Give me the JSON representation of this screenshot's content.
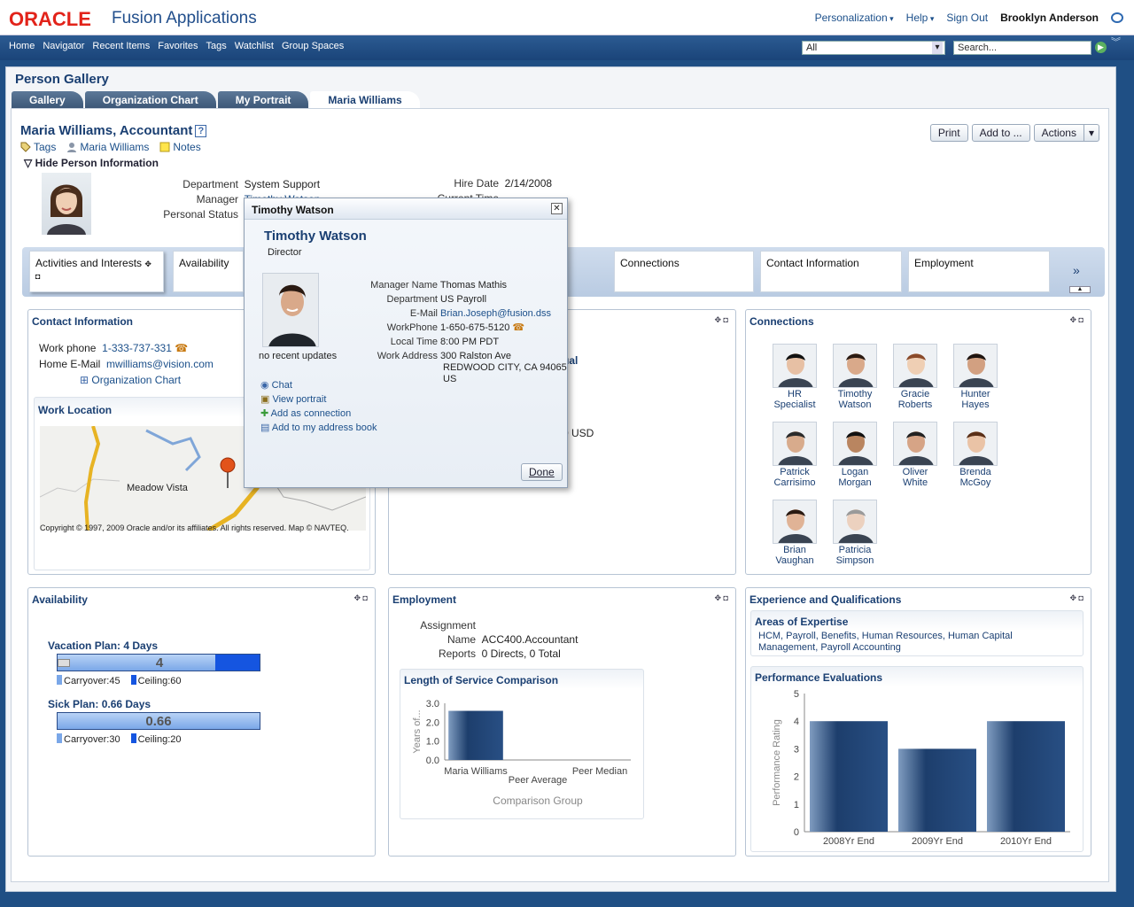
{
  "header": {
    "brand": "ORACLE",
    "product": "Fusion Applications",
    "personalization": "Personalization",
    "help": "Help",
    "signout": "Sign Out",
    "user": "Brooklyn Anderson"
  },
  "nav": {
    "links": [
      "Home",
      "Navigator",
      "Recent Items",
      "Favorites",
      "Tags",
      "Watchlist",
      "Group Spaces"
    ],
    "scope": "All",
    "search_placeholder": "Search..."
  },
  "page": {
    "title": "Person Gallery",
    "tabs": [
      "Gallery",
      "Organization Chart",
      "My Portrait",
      "Maria Williams"
    ]
  },
  "person": {
    "name": "Maria Williams, Accountant",
    "help": "?",
    "tags": "Tags",
    "self": "Maria Williams",
    "notes": "Notes",
    "hide": "Hide Person Information",
    "dept_label": "Department",
    "dept": "System Support",
    "mgr_label": "Manager",
    "mgr": "Timothy Watson",
    "status_label": "Personal Status",
    "hire_label": "Hire Date",
    "hire": "2/14/2008",
    "time_label": "Current Time"
  },
  "actions": {
    "print": "Print",
    "addto": "Add to ...",
    "actions": "Actions"
  },
  "strip": {
    "cards": [
      "Activities and Interests",
      "Availability",
      "Connections",
      "Contact Information",
      "Employment"
    ],
    "more": "»"
  },
  "contact": {
    "title": "Contact Information",
    "phone_label": "Work phone",
    "phone": "1-333-737-331",
    "email_label": "Home E-Mail",
    "email": "mwilliams@vision.com",
    "org": "Organization Chart"
  },
  "work": {
    "title": "Work Location",
    "town": "Meadow Vista",
    "copy": "Copyright © 1997, 2009 Oracle and/or its affiliates. All rights reserved. Map © NAVTEQ."
  },
  "mid": {
    "frag1": "ual",
    "frag2": "0 USD"
  },
  "connections": {
    "title": "Connections",
    "people": [
      {
        "first": "HR Specialist",
        "last": ""
      },
      {
        "first": "Timothy",
        "last": "Watson"
      },
      {
        "first": "Gracie",
        "last": "Roberts"
      },
      {
        "first": "Hunter",
        "last": "Hayes"
      },
      {
        "first": "Patrick",
        "last": "Carrisimo"
      },
      {
        "first": "Logan",
        "last": "Morgan"
      },
      {
        "first": "Oliver",
        "last": "White"
      },
      {
        "first": "Brenda",
        "last": "McGoy"
      },
      {
        "first": "Brian",
        "last": "Vaughan"
      },
      {
        "first": "Patricia",
        "last": "Simpson"
      }
    ]
  },
  "availability": {
    "title": "Availability",
    "vacation": {
      "label": "Vacation Plan: 4 Days",
      "value": "4",
      "fraction": 0.78,
      "carry": "Carryover:45",
      "ceiling": "Ceiling:60"
    },
    "sick": {
      "label": "Sick Plan: 0.66 Days",
      "value": "0.66",
      "carry": "Carryover:30",
      "ceiling": "Ceiling:20"
    }
  },
  "employment": {
    "title": "Employment",
    "assign_label": "Assignment Name",
    "assign": "ACC400.Accountant",
    "reports_label": "Reports",
    "reports": "0 Directs, 0 Total"
  },
  "los": {
    "title": "Length of Service Comparison",
    "ylabel": "Years of...",
    "xlabel": "Comparison Group"
  },
  "chart_data": [
    {
      "type": "bar",
      "title": "Length of Service Comparison",
      "categories": [
        "Maria Williams",
        "Peer Average",
        "Peer Median"
      ],
      "values": [
        2.6,
        0,
        0
      ],
      "ylim": [
        0,
        3
      ],
      "yticks": [
        "3.0",
        "2.0",
        "1.0",
        "0.0"
      ],
      "xlabel": "Comparison Group",
      "ylabel": "Years of..."
    },
    {
      "type": "bar",
      "title": "Performance Evaluations",
      "categories": [
        "2008Yr End",
        "2009Yr End",
        "2010Yr End"
      ],
      "values": [
        4,
        3,
        4
      ],
      "ylim": [
        0,
        5
      ],
      "yticks": [
        "5",
        "4",
        "3",
        "2",
        "1",
        "0"
      ],
      "ylabel": "Performance Rating",
      "xlabel": ""
    }
  ],
  "exp": {
    "title": "Experience and Qualifications",
    "areas_title": "Areas of Expertise",
    "areas": "HCM, Payroll, Benefits, Human Resources, Human Capital Management, Payroll Accounting",
    "perf_title": "Performance Evaluations",
    "perf_ylabel": "Performance Rating"
  },
  "popup": {
    "header": "Timothy Watson",
    "name": "Timothy Watson",
    "title": "Director",
    "updates": "no recent updates",
    "fields": [
      {
        "label": "Manager Name",
        "value": "Thomas Mathis"
      },
      {
        "label": "Department",
        "value": "US Payroll"
      },
      {
        "label": "E-Mail",
        "value": "Brian.Joseph@fusion.dss"
      },
      {
        "label": "WorkPhone",
        "value": "1-650-675-5120"
      },
      {
        "label": "Local Time",
        "value": "8:00 PM PDT"
      },
      {
        "label": "Work Address",
        "value": "300 Ralston Ave"
      }
    ],
    "addr2": "REDWOOD CITY, CA 94065",
    "addr3": "US",
    "links": [
      "Chat",
      "View portrait",
      "Add as connection",
      "Add to my address book"
    ],
    "done": "Done"
  }
}
